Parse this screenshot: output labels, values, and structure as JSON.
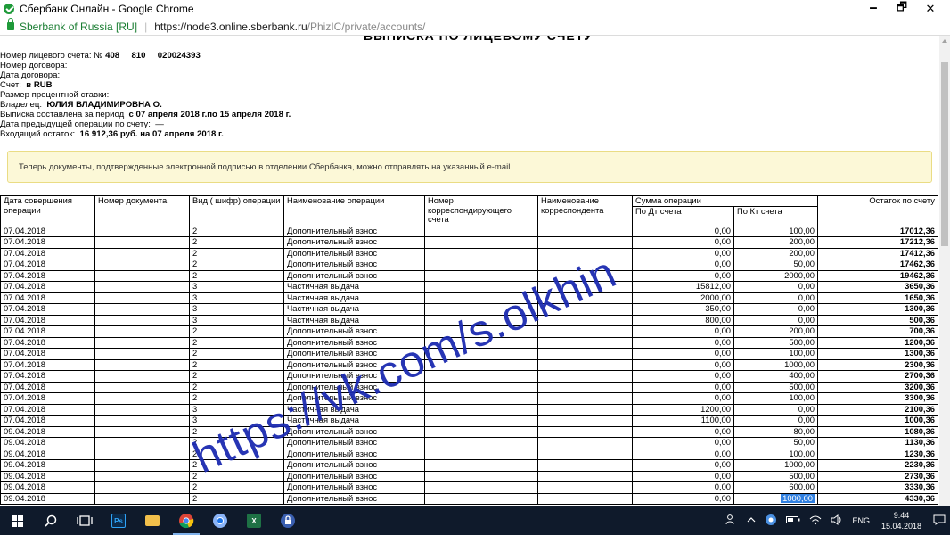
{
  "window": {
    "title": "Сбербанк Онлайн - Google Chrome",
    "min": "🗕",
    "max": "🗗",
    "close": "✕"
  },
  "addressbar": {
    "site": "Sberbank of Russia [RU]",
    "url_host": "https://node3.online.sberbank.ru",
    "url_path": "/PhizIC/private/accounts/"
  },
  "page": {
    "title": "ВЫПИСКА ПО ЛИЦЕВОМУ СЧЕТУ",
    "info": {
      "account_no_label": "Номер лицевого счета: №",
      "account_no_value": "408     810     020024393",
      "contract_no_label": "Номер договора:",
      "contract_date_label": "Дата договора:",
      "account_label": "Счет:",
      "account_value": "в RUB",
      "rate_label": "Размер процентной ставки:",
      "owner_label": "Владелец:",
      "owner_value": "ЮЛИЯ ВЛАДИМИРОВНА О.",
      "period_label": "Выписка составлена за период",
      "period_value": "с 07 апреля 2018 г.по 15 апреля 2018 г.",
      "prev_op_label": "Дата предыдущей операции по счету:",
      "prev_op_value": "—",
      "opening_label": "Входящий остаток:",
      "opening_value": "16 912,36 руб. на 07 апреля 2018 г."
    },
    "notice": "Теперь документы, подтвержденные электронной подписью в отделении Сбербанка, можно отправлять на указанный e-mail."
  },
  "table": {
    "headers": {
      "date": "Дата совершения операции",
      "doc_no": "Номер документа",
      "type": "Вид ( шифр) операции",
      "op_name": "Наименование операции",
      "corr_acc": "Номер корреспондирующего счета",
      "corr_name": "Наименование корреспондента",
      "sum": "Сумма операции",
      "debit": "По Дт счета",
      "credit": "По Кт счета",
      "balance": "Остаток по счету"
    },
    "rows": [
      {
        "date": "07.04.2018",
        "type": "2",
        "op": "Дополнительный взнос",
        "dt": "0,00",
        "kt": "100,00",
        "bal": "17012,36"
      },
      {
        "date": "07.04.2018",
        "type": "2",
        "op": "Дополнительный взнос",
        "dt": "0,00",
        "kt": "200,00",
        "bal": "17212,36"
      },
      {
        "date": "07.04.2018",
        "type": "2",
        "op": "Дополнительный взнос",
        "dt": "0,00",
        "kt": "200,00",
        "bal": "17412,36"
      },
      {
        "date": "07.04.2018",
        "type": "2",
        "op": "Дополнительный взнос",
        "dt": "0,00",
        "kt": "50,00",
        "bal": "17462,36"
      },
      {
        "date": "07.04.2018",
        "type": "2",
        "op": "Дополнительный взнос",
        "dt": "0,00",
        "kt": "2000,00",
        "bal": "19462,36"
      },
      {
        "date": "07.04.2018",
        "type": "3",
        "op": "Частичная выдача",
        "dt": "15812,00",
        "kt": "0,00",
        "bal": "3650,36"
      },
      {
        "date": "07.04.2018",
        "type": "3",
        "op": "Частичная выдача",
        "dt": "2000,00",
        "kt": "0,00",
        "bal": "1650,36"
      },
      {
        "date": "07.04.2018",
        "type": "3",
        "op": "Частичная выдача",
        "dt": "350,00",
        "kt": "0,00",
        "bal": "1300,36"
      },
      {
        "date": "07.04.2018",
        "type": "3",
        "op": "Частичная выдача",
        "dt": "800,00",
        "kt": "0,00",
        "bal": "500,36"
      },
      {
        "date": "07.04.2018",
        "type": "2",
        "op": "Дополнительный взнос",
        "dt": "0,00",
        "kt": "200,00",
        "bal": "700,36"
      },
      {
        "date": "07.04.2018",
        "type": "2",
        "op": "Дополнительный взнос",
        "dt": "0,00",
        "kt": "500,00",
        "bal": "1200,36"
      },
      {
        "date": "07.04.2018",
        "type": "2",
        "op": "Дополнительный взнос",
        "dt": "0,00",
        "kt": "100,00",
        "bal": "1300,36"
      },
      {
        "date": "07.04.2018",
        "type": "2",
        "op": "Дополнительный взнос",
        "dt": "0,00",
        "kt": "1000,00",
        "bal": "2300,36"
      },
      {
        "date": "07.04.2018",
        "type": "2",
        "op": "Дополнительный взнос",
        "dt": "0,00",
        "kt": "400,00",
        "bal": "2700,36"
      },
      {
        "date": "07.04.2018",
        "type": "2",
        "op": "Дополнительный взнос",
        "dt": "0,00",
        "kt": "500,00",
        "bal": "3200,36"
      },
      {
        "date": "07.04.2018",
        "type": "2",
        "op": "Дополнительный взнос",
        "dt": "0,00",
        "kt": "100,00",
        "bal": "3300,36"
      },
      {
        "date": "07.04.2018",
        "type": "3",
        "op": "Частичная выдача",
        "dt": "1200,00",
        "kt": "0,00",
        "bal": "2100,36"
      },
      {
        "date": "07.04.2018",
        "type": "3",
        "op": "Частичная выдача",
        "dt": "1100,00",
        "kt": "0,00",
        "bal": "1000,36"
      },
      {
        "date": "09.04.2018",
        "type": "2",
        "op": "Дополнительный взнос",
        "dt": "0,00",
        "kt": "80,00",
        "bal": "1080,36"
      },
      {
        "date": "09.04.2018",
        "type": "2",
        "op": "Дополнительный взнос",
        "dt": "0,00",
        "kt": "50,00",
        "bal": "1130,36"
      },
      {
        "date": "09.04.2018",
        "type": "2",
        "op": "Дополнительный взнос",
        "dt": "0,00",
        "kt": "100,00",
        "bal": "1230,36"
      },
      {
        "date": "09.04.2018",
        "type": "2",
        "op": "Дополнительный взнос",
        "dt": "0,00",
        "kt": "1000,00",
        "bal": "2230,36"
      },
      {
        "date": "09.04.2018",
        "type": "2",
        "op": "Дополнительный взнос",
        "dt": "0,00",
        "kt": "500,00",
        "bal": "2730,36"
      },
      {
        "date": "09.04.2018",
        "type": "2",
        "op": "Дополнительный взнос",
        "dt": "0,00",
        "kt": "600,00",
        "bal": "3330,36"
      },
      {
        "date": "09.04.2018",
        "type": "2",
        "op": "Дополнительный взнос",
        "dt": "0,00",
        "kt": "1000,00",
        "bal": "4330,36",
        "kt_selected": true
      }
    ]
  },
  "watermark": "https://vk.com/s.olkhin",
  "taskbar": {
    "apps": [
      "windows-start",
      "search",
      "task-view",
      "photoshop",
      "file-explorer",
      "chrome",
      "chrome-alt",
      "excel",
      "security-app"
    ],
    "ps_label": "Ps",
    "excel_label": "X",
    "language": "ENG",
    "time": "9:44",
    "date": "15.04.2018"
  },
  "colors": {
    "sber_green": "#1f9a3a",
    "notice_bg": "#fcf8d7",
    "watermark": "#1c2bb0",
    "selection": "#2f7fe0",
    "taskbar": "#0f1a2b"
  }
}
